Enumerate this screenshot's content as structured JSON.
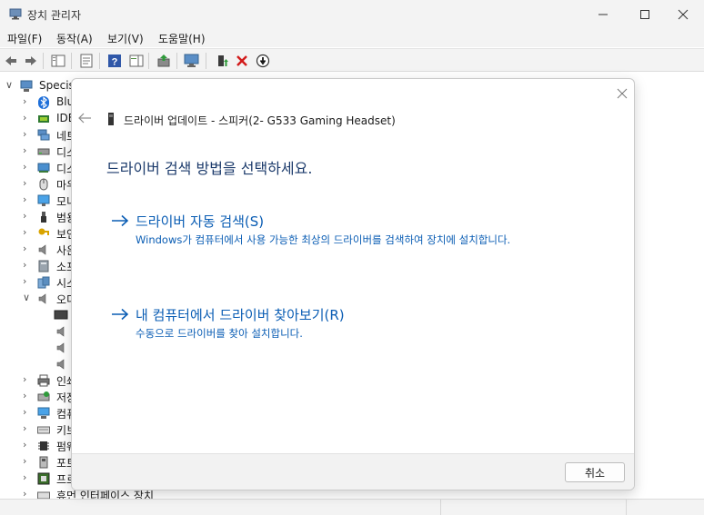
{
  "window": {
    "title": "장치 관리자"
  },
  "menu": {
    "items": [
      "파일(F)",
      "동작(A)",
      "보기(V)",
      "도움말(H)"
    ]
  },
  "toolbar": {
    "icons": [
      "back-icon",
      "forward-icon",
      "show-hide-tree-icon",
      "properties-icon",
      "help-icon",
      "action-pane-icon",
      "update-driver-icon",
      "scan-hardware-icon",
      "enable-device-icon",
      "uninstall-icon",
      "disable-icon"
    ]
  },
  "tree": {
    "root": "Specis",
    "items": [
      "Blu",
      "IDE",
      "네트",
      "디스",
      "디스",
      "마우",
      "모니",
      "범용",
      "보인",
      "사운",
      "소프",
      "시스",
      "오디",
      "",
      "",
      "",
      "인쇄",
      "저장",
      "컴퓨",
      "키보",
      "펌웨",
      "포트",
      "프로",
      "휴먼 인터페이스 장치"
    ]
  },
  "dialog": {
    "title": "드라이버 업데이트 - 스피커(2- G533 Gaming Headset)",
    "heading": "드라이버 검색 방법을 선택하세요.",
    "option_auto": {
      "title": "드라이버 자동 검색(S)",
      "description": "Windows가 컴퓨터에서 사용 가능한 최상의 드라이버를 검색하여 장치에 설치합니다."
    },
    "option_manual": {
      "title": "내 컴퓨터에서 드라이버 찾아보기(R)",
      "description": "수동으로 드라이버를 찾아 설치합니다."
    },
    "cancel_label": "취소"
  },
  "colors": {
    "link": "#0a5db4",
    "heading": "#1b3a6b",
    "chrome": "#f3f3f3"
  }
}
